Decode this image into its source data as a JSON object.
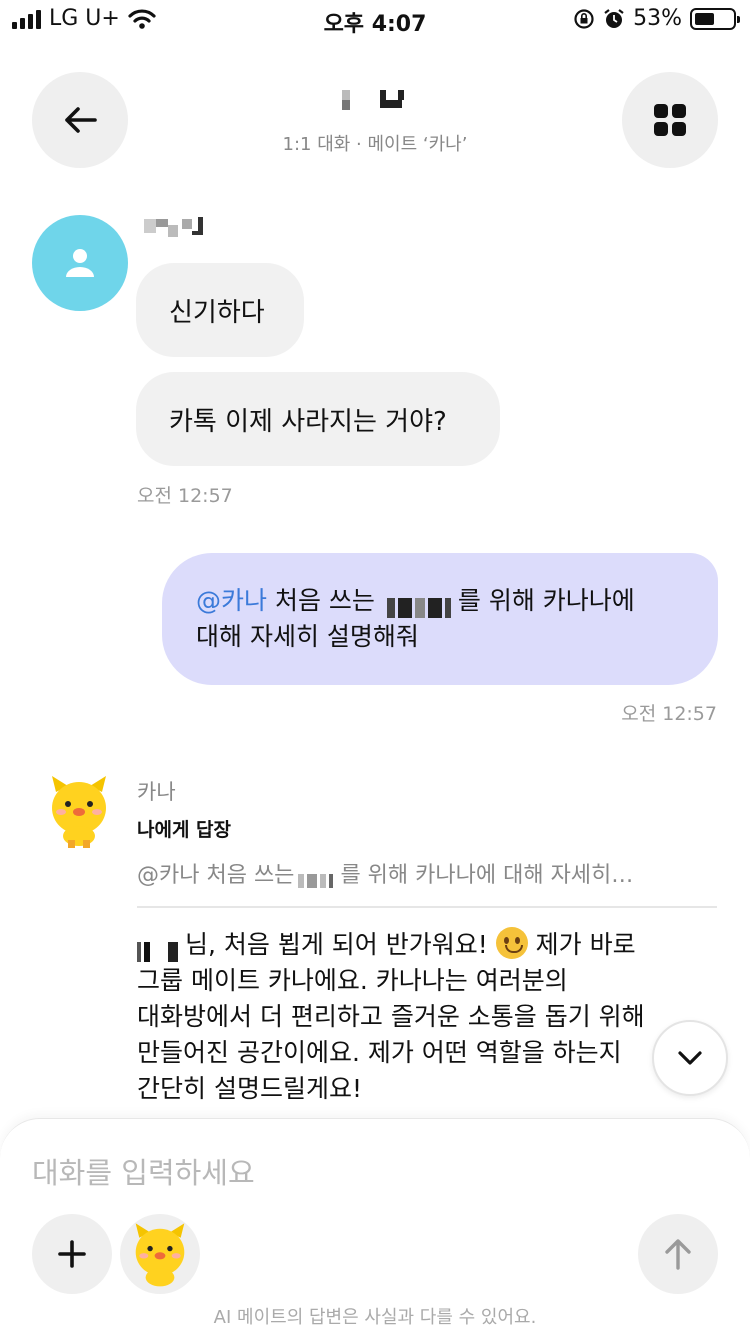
{
  "status_bar": {
    "carrier": "LG U+",
    "time": "오후 4:07",
    "battery": "53%",
    "battery_level": 0.53
  },
  "header": {
    "subtitle": "1:1 대화 · 메이트 ‘카나’"
  },
  "incoming": {
    "messages": [
      "신기하다",
      "카톡 이제 사라지는 거야?"
    ],
    "time": "오전 12:57"
  },
  "outgoing": {
    "mention": "@카나",
    "text_before": "처음 쓰는",
    "text_after": "를 위해 카나나에",
    "line2": "대해 자세히 설명해줘",
    "time": "오전 12:57"
  },
  "bot": {
    "name": "카나",
    "reply_title": "나에게 답장",
    "quote_before": "@카나 처음 쓰는",
    "quote_after": "를 위해 카나나에 대해 자세히…",
    "line1_a": "님, 처음 뵙게 되어 반가워요!",
    "line1_b": "제가 바로",
    "line2": "그룹 메이트 카나에요. 카나나는 여러분의",
    "line3": "대화방에서 더 편리하고 즐거운 소통을 돕기 위해",
    "line4": "만들어진 공간이에요. 제가 어떤 역할을 하는지",
    "line5": "간단히 설명드릴게요!"
  },
  "composer": {
    "placeholder": "대화를 입력하세요",
    "disclaimer": "AI 메이트의 답변은 사실과 다를 수 있어요."
  },
  "colors": {
    "outgoing_bubble": "#dcdcfb",
    "incoming_bubble": "#f1f1f1",
    "mention": "#3b7ad9",
    "avatar": "#6fd5ea"
  }
}
